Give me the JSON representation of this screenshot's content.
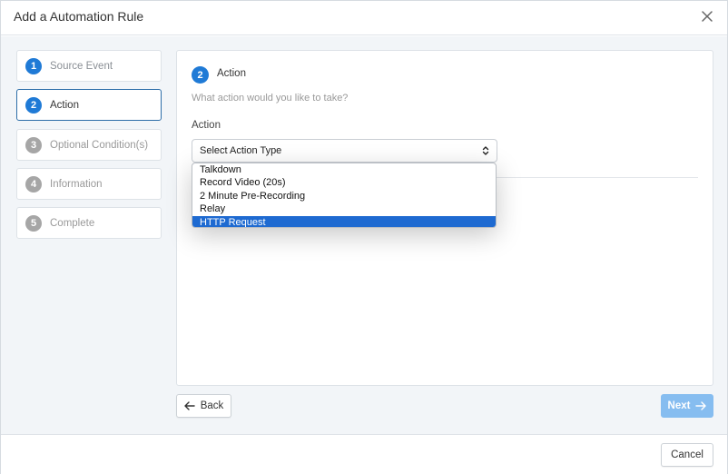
{
  "modal": {
    "title": "Add a Automation Rule"
  },
  "steps": [
    {
      "number": "1",
      "label": "Source Event"
    },
    {
      "number": "2",
      "label": "Action"
    },
    {
      "number": "3",
      "label": "Optional Condition(s)"
    },
    {
      "number": "4",
      "label": "Information"
    },
    {
      "number": "5",
      "label": "Complete"
    }
  ],
  "panel": {
    "step_number": "2",
    "title": "Action",
    "subtitle": "What action would you like to take?",
    "field_label": "Action",
    "select_value": "Select Action Type"
  },
  "dropdown": {
    "options": [
      "Talkdown",
      "Record Video (20s)",
      "2 Minute Pre-Recording",
      "Relay",
      "HTTP Request"
    ],
    "highlighted": "HTTP Request"
  },
  "buttons": {
    "back": "Back",
    "next": "Next",
    "cancel": "Cancel"
  },
  "colors": {
    "accent": "#1f7ad6",
    "inactive_step": "#a6a6a6",
    "next_disabled": "#86bdf0",
    "highlight": "#1e6ad1"
  },
  "icons": {
    "close": "close-icon",
    "back": "arrow-left-icon",
    "next": "arrow-right-icon",
    "select": "chevron-up-down-icon"
  }
}
